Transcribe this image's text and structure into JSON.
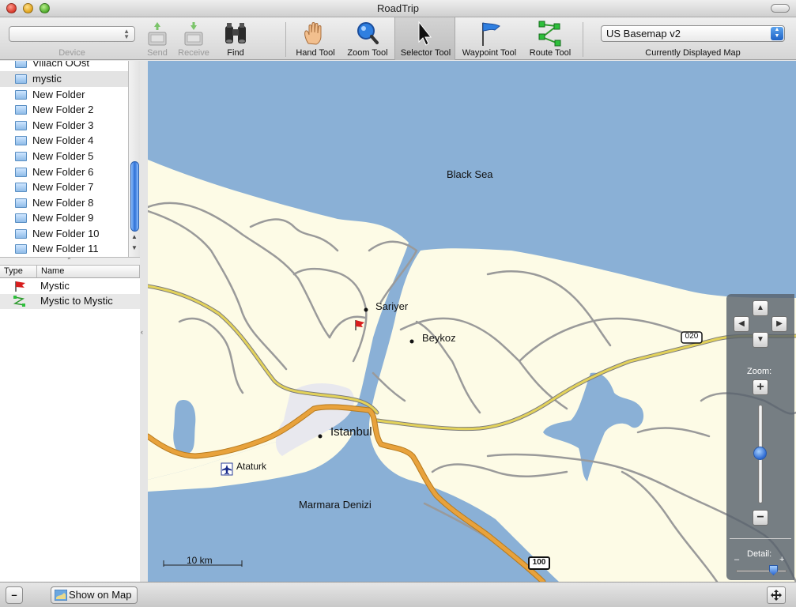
{
  "window": {
    "title": "RoadTrip"
  },
  "toolbar": {
    "device_label": "Device",
    "send_label": "Send",
    "receive_label": "Receive",
    "find_label": "Find",
    "hand_tool_label": "Hand Tool",
    "zoom_tool_label": "Zoom Tool",
    "selector_tool_label": "Selector Tool",
    "waypoint_tool_label": "Waypoint Tool",
    "route_tool_label": "Route Tool",
    "map_select_value": "US Basemap v2",
    "map_select_caption": "Currently Displayed Map"
  },
  "sidebar": {
    "folders": [
      "Villach OOst",
      "mystic",
      "New Folder",
      "New Folder 2",
      "New Folder 3",
      "New Folder 4",
      "New Folder 5",
      "New Folder 6",
      "New Folder 7",
      "New Folder 8",
      "New Folder 9",
      "New Folder 10",
      "New Folder 11"
    ],
    "selected_folder": "mystic",
    "columns": {
      "type": "Type",
      "name": "Name"
    },
    "items": [
      {
        "type_icon": "waypoint-flag-icon",
        "name": "Mystic"
      },
      {
        "type_icon": "route-icon",
        "name": "Mystic to Mystic"
      }
    ]
  },
  "map": {
    "labels": {
      "black_sea": "Black Sea",
      "sariyer": "Sariyer",
      "beykoz": "Beykoz",
      "istanbul": "Istanbul",
      "ataturk": "Ataturk",
      "marmara": "Marmara Denizi"
    },
    "road_shields": {
      "r020": "020",
      "r100": "100"
    },
    "scale_label": "10 km",
    "colors": {
      "water": "#8ab0d6",
      "land": "#fdfbe6",
      "highway": "#e8a23c",
      "major_road": "#e3d25a",
      "minor_road": "#9a9a9a"
    }
  },
  "zoom_panel": {
    "zoom_label": "Zoom:",
    "detail_label": "Detail:",
    "detail_minus": "–",
    "detail_plus": "+",
    "zoom_level_fraction": 0.48,
    "detail_level_fraction": 0.85
  },
  "bottom": {
    "minus_label": "–",
    "show_on_map_label": "Show on Map"
  }
}
